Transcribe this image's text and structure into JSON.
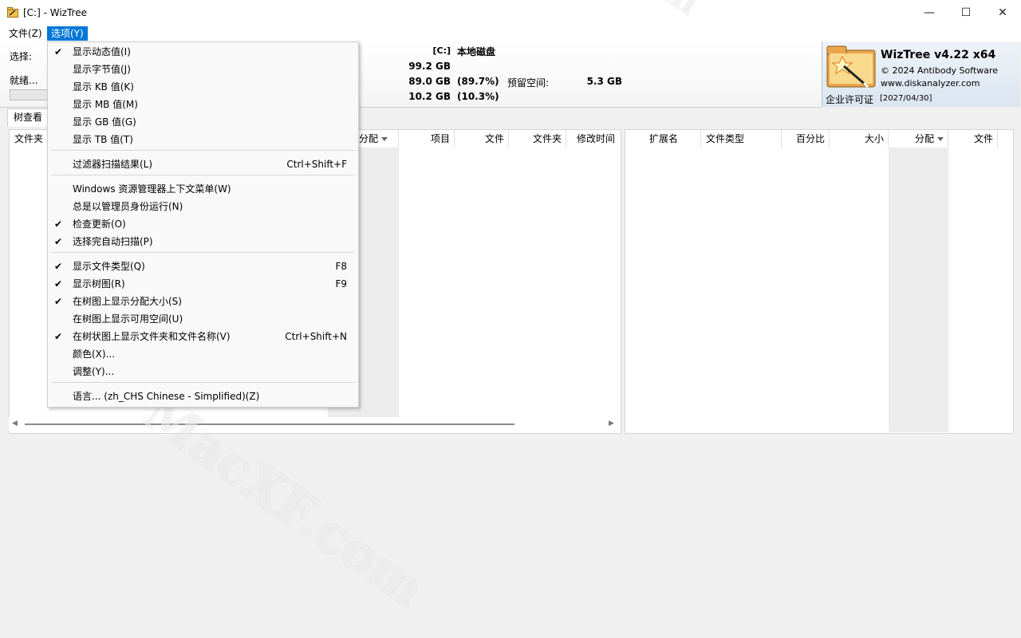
{
  "window": {
    "title": "[C:]  - WizTree",
    "minimize_glyph": "—",
    "maximize_glyph": "☐",
    "close_glyph": "✕"
  },
  "menubar": {
    "file": "文件(Z)",
    "options": "选项(Y)"
  },
  "info": {
    "select_label": "选择:",
    "status": "就绪...",
    "drive": "[C:]",
    "drive_name": "本地磁盘",
    "total": "99.2 GB",
    "used": "89.0 GB",
    "used_pct": "(89.7%)",
    "free": "10.2 GB",
    "free_pct": "(10.3%)",
    "reserved_label": "预留空间:",
    "reserved_value": "5.3 GB"
  },
  "brand": {
    "name": "WizTree v4.22 x64",
    "copyright": "© 2024 Antibody Software",
    "website": "www.diskanalyzer.com",
    "license_label": "企业许可证",
    "license_date": "[2027/04/30]"
  },
  "tabs": {
    "tree": "树查看"
  },
  "left_table": {
    "headers": [
      "文件夹",
      "分配",
      "项目",
      "文件",
      "文件夹",
      "修改时间"
    ]
  },
  "right_table": {
    "headers": [
      "扩展名",
      "文件类型",
      "百分比",
      "大小",
      "分配",
      "文件"
    ]
  },
  "options_menu": [
    {
      "checked": true,
      "label": "显示动态值(I)",
      "shortcut": ""
    },
    {
      "checked": false,
      "label": "显示字节值(J)",
      "shortcut": ""
    },
    {
      "checked": false,
      "label": "显示 KB 值(K)",
      "shortcut": ""
    },
    {
      "checked": false,
      "label": "显示 MB 值(M)",
      "shortcut": ""
    },
    {
      "checked": false,
      "label": "显示 GB 值(G)",
      "shortcut": ""
    },
    {
      "checked": false,
      "label": "显示 TB 值(T)",
      "shortcut": ""
    },
    {
      "checked": false,
      "label": "过滤器扫描结果(L)",
      "shortcut": "Ctrl+Shift+F"
    },
    {
      "checked": false,
      "label": "Windows 资源管理器上下文菜单(W)",
      "shortcut": ""
    },
    {
      "checked": false,
      "label": "总是以管理员身份运行(N)",
      "shortcut": ""
    },
    {
      "checked": true,
      "label": "检查更新(O)",
      "shortcut": ""
    },
    {
      "checked": true,
      "label": "选择完自动扫描(P)",
      "shortcut": ""
    },
    {
      "checked": true,
      "label": "显示文件类型(Q)",
      "shortcut": "F8"
    },
    {
      "checked": true,
      "label": "显示树图(R)",
      "shortcut": "F9"
    },
    {
      "checked": true,
      "label": "在树图上显示分配大小(S)",
      "shortcut": ""
    },
    {
      "checked": false,
      "label": "在树图上显示可用空间(U)",
      "shortcut": ""
    },
    {
      "checked": true,
      "label": "在树状图上显示文件夹和文件名称(V)",
      "shortcut": "Ctrl+Shift+N"
    },
    {
      "checked": false,
      "label": "颜色(X)...",
      "shortcut": ""
    },
    {
      "checked": false,
      "label": "调整(Y)...",
      "shortcut": ""
    },
    {
      "checked": false,
      "label": "语言... (zh_CHS Chinese - Simplified)(Z)",
      "shortcut": ""
    }
  ],
  "check_glyph": "✔",
  "scroll": {
    "left_arrow": "◀",
    "right_arrow": "▶"
  },
  "watermarks": [
    "MacXF.com",
    "m"
  ],
  "colors": {
    "menu_highlight": "#0078d7",
    "background": "#f0f0f0"
  },
  "icons": {
    "app": "wiztree-app-icon",
    "logo": "wiztree-wand-logo"
  }
}
